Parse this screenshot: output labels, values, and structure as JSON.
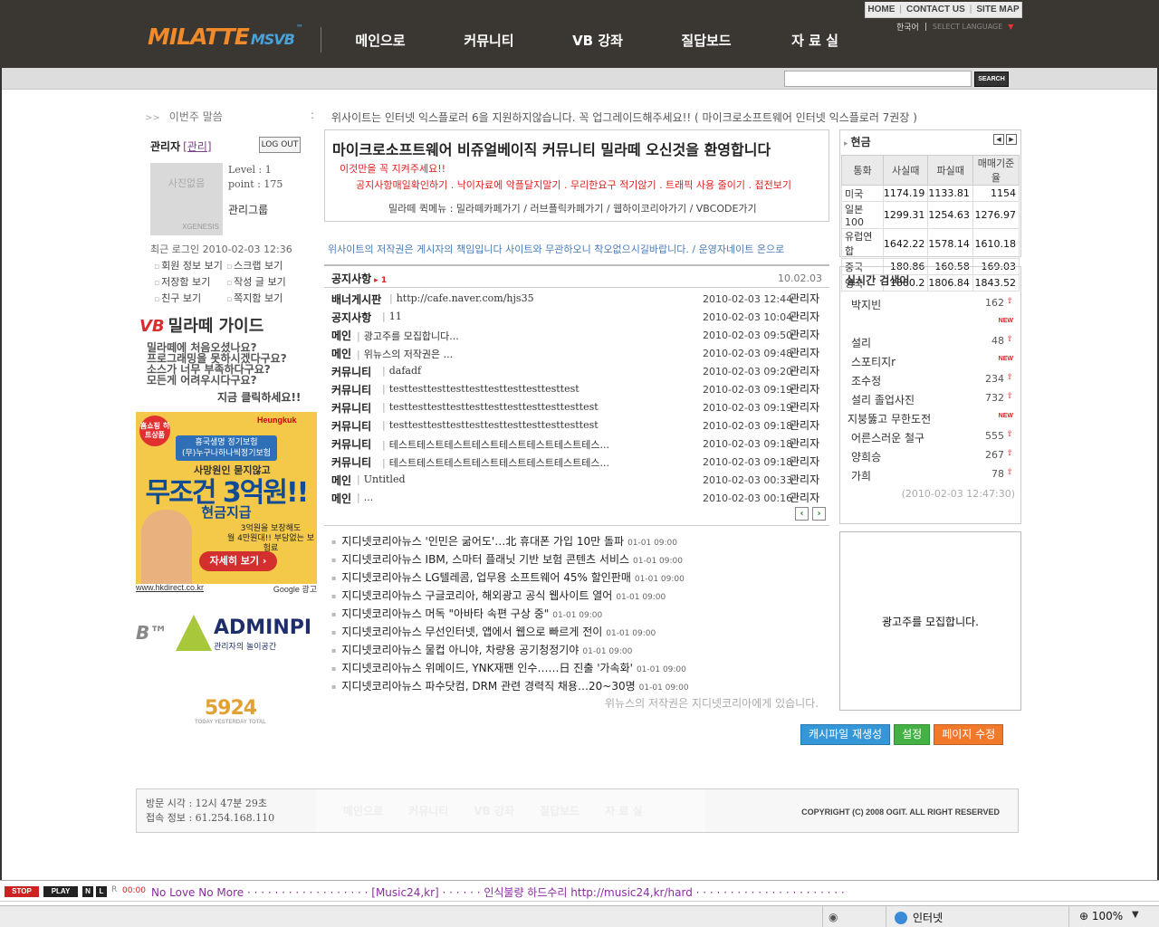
{
  "header": {
    "logo_main": "MILATTE",
    "logo_sub": "MSVB",
    "logo_tm": "™",
    "nav": [
      "메인으로",
      "커뮤니티",
      "VB 강좌",
      "질답보드",
      "자 료 실"
    ],
    "util": [
      "HOME",
      "CONTACT US",
      "SITE MAP"
    ],
    "lang": "한국어",
    "lang_select": "SELECT LANGUAGE",
    "search_button": "SEARCH"
  },
  "notice_line": {
    "label": "이번주 말씀",
    "arrow": ">>",
    "colon": ":",
    "ticker": "위사이트는 인터넷 익스플로러 6을 지원하지않습니다. 꼭 업그레이드해주세요!!  ( 마이크로소프트웨어 인터넷 익스플로러 7권장 )"
  },
  "login": {
    "admin": "관리자",
    "admin_link": "[관리]",
    "logout": "LOG OUT",
    "photo_text": "사진없음",
    "photo_sub": "XGENESIS",
    "level": "Level : 1",
    "point": "point : 175",
    "group": "관리그룹",
    "recent": "최근 로그인  2010-02-03 12:36",
    "menu": [
      "회원 정보 보기",
      "스크랩 보기",
      "저장함 보기",
      "작성 글 보기",
      "친구 보기",
      "쪽지함 보기"
    ]
  },
  "guide": {
    "vb": "VB",
    "title": "밀라떼 가이드",
    "lines": [
      "밀라떼에 처음오셨나요?",
      "프로그래밍을 못하시겠다구요?",
      "소스가 너무 부족하다구요?",
      "모든게 어려우시다구요?"
    ],
    "click": "지금 클릭하세요!!"
  },
  "ad": {
    "tag": "홈쇼핑 히트상품",
    "brand": "Heungkuk",
    "line1": "흥국생명 정기보험",
    "line2": "(무)누구나하나씩정기보험",
    "line3": "사망원인 묻지않고",
    "line4": "무조건 3억원!!",
    "line5": "현금지급",
    "line6a": "3억원을 보장해도",
    "line6b": "월 4만원대!! 부담없는 보험료",
    "button": "자세히 보기 ›",
    "url": "www.hkdirect.co.kr",
    "google": "Google 광고"
  },
  "admin_banner": {
    "prefix": "B™",
    "name": "ADMINPL",
    "sub": "관리자의 놀이공간"
  },
  "counter": {
    "number": "5924",
    "label": "TODAY YESTERDAY TOTAL"
  },
  "welcome": {
    "title": "마이크로소프트웨어 비쥬얼베이직 커뮤니티 밀라떼 오신것을 환영합니다",
    "rule1": "이것만을 꼭 지켜주세요!!",
    "rule2": "공지사항매일확인하기 . 낙이자료에 악플달지말기 . 무리한요구 적기않기 . 트래픽 사용 줄이기 . 접전보기",
    "menu": "밀라떼 퀵메뉴 : 밀라떼카페가기 / 러브플릭카페가기 / 웹하이코리아가기 / VBCODE가기"
  },
  "copyright_line": "위사이트의 저작권은 게시자의 책임입니다 사이트와 무관하오니 착오없으시길바랍니다. / 운영자네이트 온으로",
  "board": {
    "title": "공지사항",
    "mark": "▸ 1",
    "date": "10.02.03",
    "rows": [
      {
        "cat": "배너게시판",
        "title": "http://cafe.naver.com/hjs35",
        "date": "2010-02-03 12:44",
        "author": "관리자"
      },
      {
        "cat": "공지사항",
        "title": "11",
        "date": "2010-02-03 10:04",
        "author": "관리자"
      },
      {
        "cat": "메인",
        "title": "광고주를 모집합니다...",
        "date": "2010-02-03 09:50",
        "author": "관리자"
      },
      {
        "cat": "메인",
        "title": "위뉴스의 저작권은 ...",
        "date": "2010-02-03 09:48",
        "author": "관리자"
      },
      {
        "cat": "커뮤니티",
        "title": "dafadf",
        "date": "2010-02-03 09:20",
        "author": "관리자"
      },
      {
        "cat": "커뮤니티",
        "title": "testtesttesttesttesttesttesttesttesttest",
        "date": "2010-02-03 09:19",
        "author": "관리자"
      },
      {
        "cat": "커뮤니티",
        "title": "testtesttesttesttesttesttesttesttesttesttest",
        "date": "2010-02-03 09:19",
        "author": "관리자"
      },
      {
        "cat": "커뮤니티",
        "title": "testtesttesttesttesttesttesttesttesttesttest",
        "date": "2010-02-03 09:18",
        "author": "관리자"
      },
      {
        "cat": "커뮤니티",
        "title": "테스트테스트테스트테스트테스트테스트테스트테스...",
        "date": "2010-02-03 09:18",
        "author": "관리자"
      },
      {
        "cat": "커뮤니티",
        "title": "테스트테스트테스트테스트테스트테스트테스트테스...",
        "date": "2010-02-03 09:18",
        "author": "관리자"
      },
      {
        "cat": "메인",
        "title": "Untitled",
        "date": "2010-02-03 00:33",
        "author": "관리자"
      },
      {
        "cat": "메인",
        "title": "...",
        "date": "2010-02-03 00:16",
        "author": "관리자"
      }
    ],
    "prev": "‹",
    "next": "›"
  },
  "news": {
    "rows": [
      {
        "text": "지디넷코리아뉴스 '인민은 굶어도'…北 휴대폰 가입 10만 돌파",
        "time": "01-01 09:00"
      },
      {
        "text": "지디넷코리아뉴스 IBM, 스마터 플래닛 기반 보험 콘텐츠 서비스",
        "time": "01-01 09:00"
      },
      {
        "text": "지디넷코리아뉴스 LG텔레콤, 업무용 소프트웨어 45% 할인판매",
        "time": "01-01 09:00"
      },
      {
        "text": "지디넷코리아뉴스 구글코리아, 해외광고 공식 웹사이트 열어",
        "time": "01-01 09:00"
      },
      {
        "text": "지디넷코리아뉴스 머독 \"아바타 속편 구상 중\"",
        "time": "01-01 09:00"
      },
      {
        "text": "지디넷코리아뉴스 무선인터넷, 앱에서 웹으로 빠르게 전이",
        "time": "01-01 09:00"
      },
      {
        "text": "지디넷코리아뉴스 물컵 아니야, 차량용 공기청정기야",
        "time": "01-01 09:00"
      },
      {
        "text": "지디넷코리아뉴스 위메이드, YNK재팬 인수……日 진출 '가속화'",
        "time": "01-01 09:00"
      },
      {
        "text": "지디넷코리아뉴스 파수닷컴, DRM 관련 경력직 채용…20~30명",
        "time": "01-01 09:00"
      }
    ],
    "copyright": "위뉴스의 저작권은 지디넷코리아에게 있습니다."
  },
  "rates": {
    "title": "현금",
    "prev": "◀",
    "next": "▶",
    "headers": [
      "통화",
      "사실때",
      "파실때",
      "매매기준율"
    ],
    "rows": [
      {
        "c": "미국",
        "buy": "1174.19",
        "sell": "1133.81",
        "base": "1154"
      },
      {
        "c": "일본 100",
        "buy": "1299.31",
        "sell": "1254.63",
        "base": "1276.97"
      },
      {
        "c": "유럽연합",
        "buy": "1642.22",
        "sell": "1578.14",
        "base": "1610.18"
      },
      {
        "c": "중국",
        "buy": "180.86",
        "sell": "160.58",
        "base": "169.03"
      },
      {
        "c": "영국",
        "buy": "1880.2",
        "sell": "1806.84",
        "base": "1843.52"
      }
    ]
  },
  "realtime": {
    "title": "실시간 검색어",
    "rows": [
      {
        "kw": "박지빈",
        "num": "162",
        "mark": "up",
        "indent": 4
      },
      {
        "kw": "",
        "num": "",
        "mark": "new",
        "indent": 4
      },
      {
        "kw": "설리",
        "num": "48",
        "mark": "up",
        "indent": 4
      },
      {
        "kw": "스포티지r",
        "num": "",
        "mark": "new",
        "indent": 4
      },
      {
        "kw": "조수정",
        "num": "234",
        "mark": "up",
        "indent": 4
      },
      {
        "kw": "설리 졸업사진",
        "num": "732",
        "mark": "up",
        "indent": 4
      },
      {
        "kw": "지붕뚫고 무한도전",
        "num": "",
        "mark": "new",
        "indent": 0
      },
      {
        "kw": "어른스러운 철구",
        "num": "555",
        "mark": "up",
        "indent": 4
      },
      {
        "kw": "양희승",
        "num": "267",
        "mark": "up",
        "indent": 4
      },
      {
        "kw": "가희",
        "num": "78",
        "mark": "up",
        "indent": 4
      }
    ],
    "up_symbol": "⇧",
    "new_label": "NEW",
    "time": "(2010-02-03 12:47:30)"
  },
  "adbox": "광고주를 모집합니다.",
  "buttons": [
    "캐시파일 재생성",
    "설정",
    "페이지 수정"
  ],
  "footer": {
    "visit_time": "방문 시각 : 12시 47분 29초",
    "visit_ip": "접속 정보 : 61.254.168.110",
    "ghost_nav": [
      "메인으로",
      "커뮤니티",
      "VB 강좌",
      "질답보드",
      "자 료 실"
    ],
    "copyright": "COPYRIGHT (C) 2008 OGIT. ALL RIGHT RESERVED"
  },
  "music": {
    "stop": "STOP",
    "play": "PLAY",
    "n": "N",
    "l": "L",
    "info": "R",
    "time": "00:00",
    "song": "No Love No More · · · · · · · · · · · · · · · · · · [Music24,kr] · · · · · · 인식불량 하드수리 http://music24,kr/hard · · · · · · · · · · · · · · · · · · · · · ·"
  },
  "status": {
    "zone": "인터넷",
    "zoom": "100%"
  }
}
